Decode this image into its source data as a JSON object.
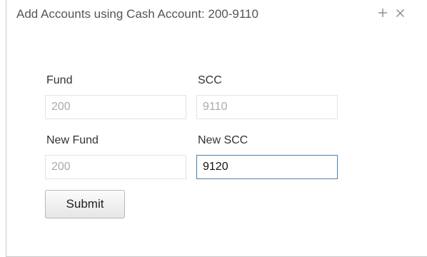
{
  "dialog": {
    "title": "Add Accounts using Cash Account: 200-9110",
    "maximize_icon": "plus-icon",
    "close_icon": "close-icon"
  },
  "form": {
    "fund": {
      "label": "Fund",
      "value": "200"
    },
    "scc": {
      "label": "SCC",
      "value": "9110"
    },
    "new_fund": {
      "label": "New Fund",
      "value": "200"
    },
    "new_scc": {
      "label": "New SCC",
      "value": "9120"
    },
    "submit_label": "Submit"
  }
}
